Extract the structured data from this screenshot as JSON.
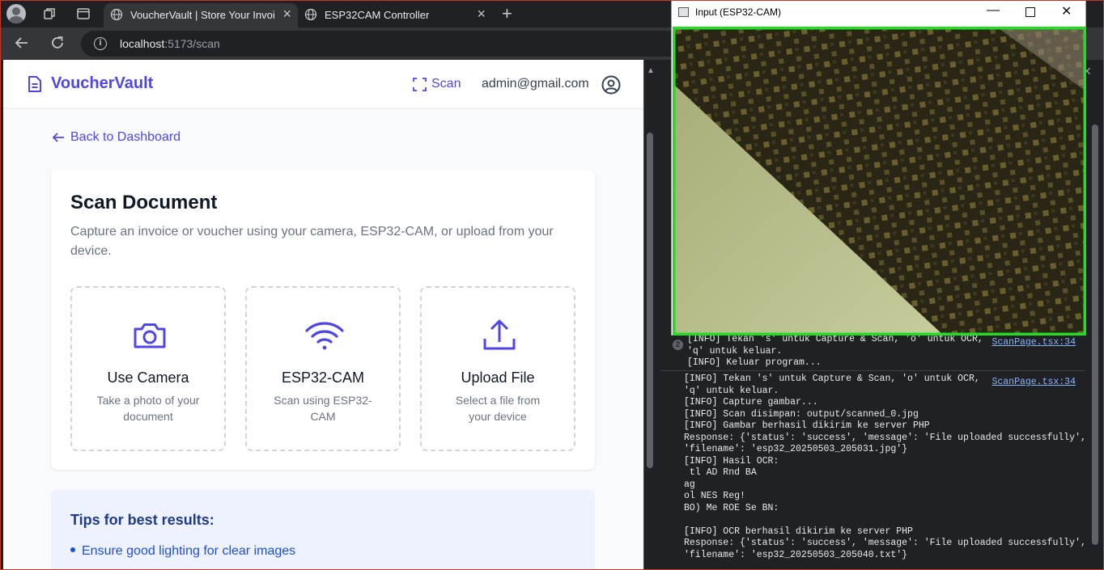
{
  "browser": {
    "tabs": [
      {
        "title": "VoucherVault | Store Your Invoices",
        "active": true
      },
      {
        "title": "ESP32CAM Controller",
        "active": false
      }
    ],
    "url_host": "localhost",
    "url_path": ":5173/scan"
  },
  "navbar": {
    "brand": "VoucherVault",
    "scan_label": "Scan",
    "user_email": "admin@gmail.com"
  },
  "back_link": "Back to Dashboard",
  "scan_card": {
    "title": "Scan Document",
    "description": "Capture an invoice or voucher using your camera, ESP32-CAM, or upload from your device.",
    "options": [
      {
        "icon": "camera-icon",
        "title": "Use Camera",
        "description": "Take a photo of your document"
      },
      {
        "icon": "wifi-icon",
        "title": "ESP32-CAM",
        "description": "Scan using ESP32-CAM"
      },
      {
        "icon": "upload-icon",
        "title": "Upload File",
        "description": "Select a file from your device"
      }
    ]
  },
  "tips": {
    "title": "Tips for best results:",
    "items": [
      "Ensure good lighting for clear images"
    ]
  },
  "camera_window": {
    "title": "Input (ESP32-CAM)"
  },
  "console": {
    "entries": [
      {
        "count": "2",
        "source": "ScanPage.tsx:34",
        "text": "[INFO] Tekan 's' untuk Capture & Scan, 'o' untuk OCR,\n'q' untuk keluar.\n[INFO] Keluar program..."
      },
      {
        "source": "ScanPage.tsx:34",
        "text": "[INFO] Tekan 's' untuk Capture & Scan, 'o' untuk OCR,\n'q' untuk keluar.\n[INFO] Capture gambar...\n[INFO] Scan disimpan: output/scanned_0.jpg\n[INFO] Gambar berhasil dikirim ke server PHP\nResponse: {'status': 'success', 'message': 'File uploaded successfully',\n'filename': 'esp32_20250503_205031.jpg'}\n[INFO] Hasil OCR:\n tl AD Rnd BA\nag\nol NES Reg!\nBO) Me ROE Se BN:\n\n[INFO] OCR berhasil dikirim ke server PHP\nResponse: {'status': 'success', 'message': 'File uploaded successfully',\n'filename': 'esp32_20250503_205040.txt'}"
      }
    ]
  },
  "colors": {
    "accent": "#4f46e5",
    "console_link": "#8ab4f8",
    "camera_frame": "#22dd22"
  }
}
